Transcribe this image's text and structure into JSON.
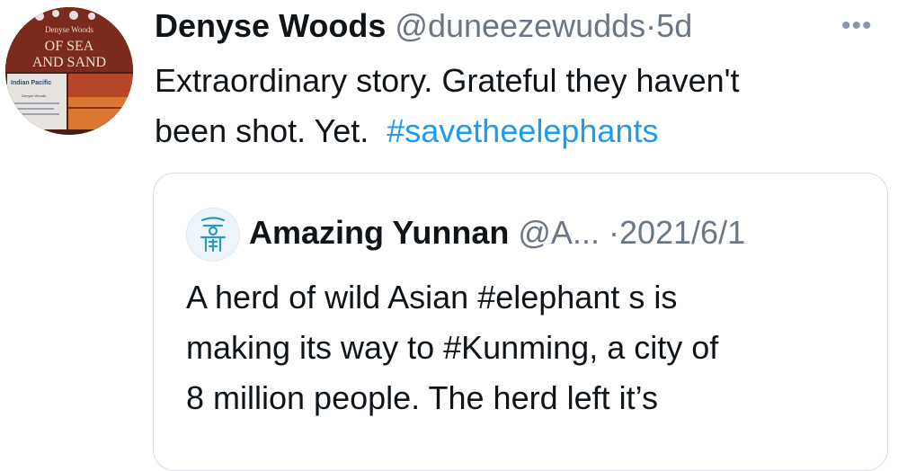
{
  "tweet": {
    "author_name": "Denyse Woods",
    "handle": "@duneezewudds",
    "separator": "·",
    "time": "5d",
    "more_glyph": "•••",
    "text_line1": "Extraordinary story. Grateful they haven't",
    "text_line2": "been shot. Yet.",
    "hashtag": "#savetheelephants",
    "avatar": {
      "icon": "book-cover-avatar",
      "title_author": "Denyse Woods",
      "title_line1": "OF SEA",
      "title_line2": "AND SAND",
      "label": "Indian Pacific",
      "label_sub": "Denyse Woods"
    }
  },
  "quoted_tweet": {
    "author_name": "Amazing Yunnan",
    "handle": "@A...",
    "separator": "·",
    "date": "2021/6/1",
    "line1": "A herd of wild Asian #elephant s is",
    "line2": "making its way to #Kunming, a city of",
    "line3": "8 million people. The herd left it’s",
    "avatar_icon": "yunnan-emblem-icon"
  },
  "colors": {
    "link": "#1d9bf0",
    "secondary_text": "#6b7785",
    "border": "#d7dde3",
    "emblem": "#2a9db5"
  }
}
